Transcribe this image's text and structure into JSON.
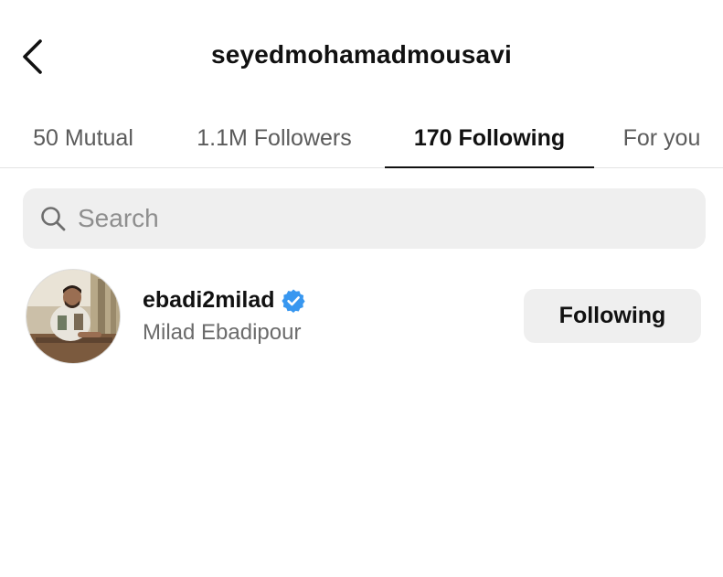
{
  "header": {
    "back_icon": "chevron-left-icon",
    "title": "seyedmohamadmousavi"
  },
  "tabs": [
    {
      "label": "50 Mutual",
      "active": false
    },
    {
      "label": "1.1M Followers",
      "active": false
    },
    {
      "label": "170 Following",
      "active": true
    },
    {
      "label": "For you",
      "active": false
    }
  ],
  "search": {
    "icon": "search-icon",
    "placeholder": "Search"
  },
  "users": [
    {
      "username": "ebadi2milad",
      "verified": true,
      "full_name": "Milad Ebadipour",
      "button_label": "Following"
    }
  ],
  "colors": {
    "verified_badge": "#3897f0",
    "button_bg": "#efefef",
    "secondary_text": "#6b6b6b"
  }
}
